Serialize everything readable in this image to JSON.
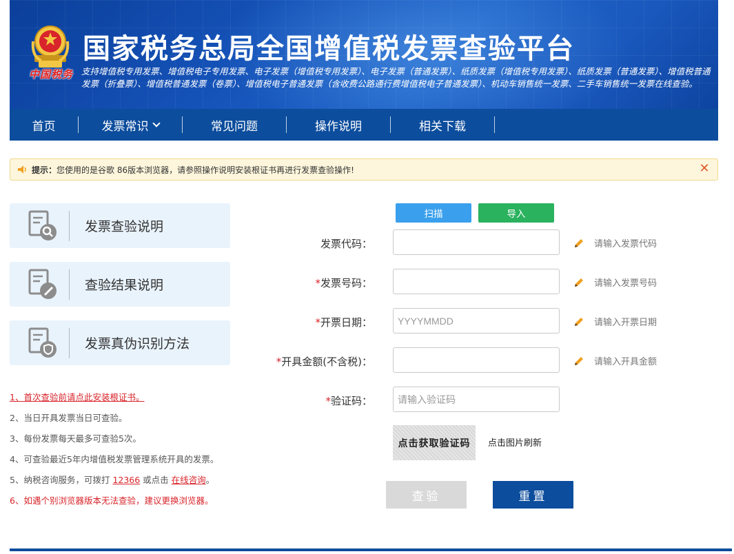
{
  "header": {
    "title": "国家税务总局全国增值税发票查验平台",
    "logo_text": "中国税务",
    "subtitle": "支持增值税专用发票、增值税电子专用发票、电子发票（增值税专用发票）、电子发票（普通发票）、纸质发票（增值税专用发票）、纸质发票（普通发票）、增值税普通发票（折叠票）、增值税普通发票（卷票）、增值税电子普通发票（含收费公路通行费增值税电子普通发票）、机动车销售统一发票、二手车销售统一发票在线查验。"
  },
  "nav": {
    "items": [
      {
        "label": "首页"
      },
      {
        "label": "发票常识"
      },
      {
        "label": "常见问题"
      },
      {
        "label": "操作说明"
      },
      {
        "label": "相关下载"
      }
    ]
  },
  "notice": {
    "prefix": "提示：",
    "text": "您使用的是谷歌 86版本浏览器，请参照操作说明安装根证书再进行发票查验操作!",
    "close": "✕"
  },
  "cards": [
    {
      "label": "发票查验说明"
    },
    {
      "label": "查验结果说明"
    },
    {
      "label": "发票真伪识别方法"
    }
  ],
  "notes": {
    "n1": "1、首次查验前请点此安装根证书。",
    "n2": "2、当日开具发票当日可查验。",
    "n3": "3、每份发票每天最多可查验5次。",
    "n4": "4、可查验最近5年内增值税发票管理系统开具的发票。",
    "n5_prefix": "5、纳税咨询服务，可拨打 ",
    "n5_phone": "12366",
    "n5_mid": " 或点击 ",
    "n5_link": "在线咨询",
    "n5_suffix": "。",
    "n6": "6、如遇个别浏览器版本无法查验，建议更换浏览器。"
  },
  "form": {
    "scan_label": "扫描",
    "import_label": "导入",
    "code_label": "发票代码：",
    "number_label": "发票号码：",
    "date_label": "开票日期：",
    "amount_label": "开具金额(不含税)：",
    "verify_label": "验证码：",
    "required_mark": "*",
    "code_value": "",
    "number_value": "",
    "date_placeholder": "YYYYMMDD",
    "amount_value": "",
    "verify_placeholder": "请输入验证码",
    "code_hint": "请输入发票代码",
    "number_hint": "请输入发票号码",
    "date_hint": "请输入开票日期",
    "amount_hint": "请输入开具金额",
    "captcha_text": "点击获取验证码",
    "refresh_text": "点击图片刷新",
    "check_label": "查验",
    "reset_label": "重置"
  },
  "colors": {
    "nav_bg": "#0c4d9d",
    "accent_red": "#d8242a",
    "scan_blue": "#3aa0ed",
    "import_green": "#2ab25e"
  }
}
